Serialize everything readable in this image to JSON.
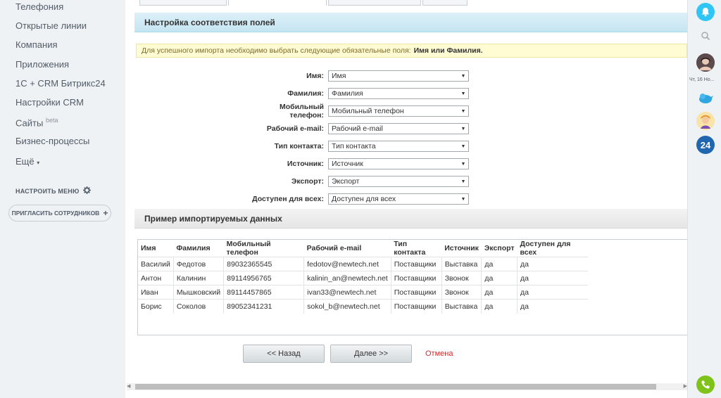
{
  "sidebar": {
    "items": [
      {
        "label": "Телефония"
      },
      {
        "label": "Открытые линии"
      },
      {
        "label": "Компания"
      },
      {
        "label": "Приложения"
      },
      {
        "label": "1С + CRM Битрикс24"
      },
      {
        "label": "Настройки CRM"
      },
      {
        "label": "Сайты",
        "badge": "beta"
      },
      {
        "label": "Бизнес-процессы"
      },
      {
        "label": "Ещё"
      }
    ],
    "setup_menu": "НАСТРОИТЬ МЕНЮ",
    "invite": "ПРИГЛАСИТЬ СОТРУДНИКОВ"
  },
  "main": {
    "mapping_title": "Настройка соответствия полей",
    "notice_text": "Для успешного импорта необходимо выбрать следующие обязательные поля:",
    "notice_required": "Имя или Фамилия.",
    "fields": [
      {
        "label": "Имя:",
        "value": "Имя"
      },
      {
        "label": "Фамилия:",
        "value": "Фамилия"
      },
      {
        "label": "Мобильный телефон:",
        "value": "Мобильный телефон"
      },
      {
        "label": "Рабочий e-mail:",
        "value": "Рабочий e-mail"
      },
      {
        "label": "Тип контакта:",
        "value": "Тип контакта"
      },
      {
        "label": "Источник:",
        "value": "Источник"
      },
      {
        "label": "Экспорт:",
        "value": "Экспорт"
      },
      {
        "label": "Доступен для всех:",
        "value": "Доступен для всех"
      }
    ],
    "preview_title": "Пример импортируемых данных",
    "table": {
      "headers": [
        "Имя",
        "Фамилия",
        "Мобильный телефон",
        "Рабочий e-mail",
        "Тип контакта",
        "Источник",
        "Экспорт",
        "Доступен для всех"
      ],
      "rows": [
        [
          "Василий",
          "Федотов",
          "89032365545",
          "fedotov@newtech.net",
          "Поставщики",
          "Выставка",
          "да",
          "да"
        ],
        [
          "Антон",
          "Калинин",
          "89114956765",
          "kalinin_an@newtech.net",
          "Поставщики",
          "Звонок",
          "да",
          "да"
        ],
        [
          "Иван",
          "Мышковский",
          "89114457865",
          "ivan33@newtech.net",
          "Поставщики",
          "Звонок",
          "да",
          "да"
        ],
        [
          "Борис",
          "Соколов",
          "89052341231",
          "sokol_b@newtech.net",
          "Поставщики",
          "Выставка",
          "да",
          "да"
        ]
      ]
    },
    "back_button": "<< Назад",
    "next_button": "Далее >>",
    "cancel_link": "Отмена"
  },
  "right_panel": {
    "date": "Чт, 16 Но...",
    "b24_label": "24",
    "colors": {
      "bell": "#2fc6f6",
      "b24": "#2067b0",
      "phone": "#7fc31a"
    }
  }
}
